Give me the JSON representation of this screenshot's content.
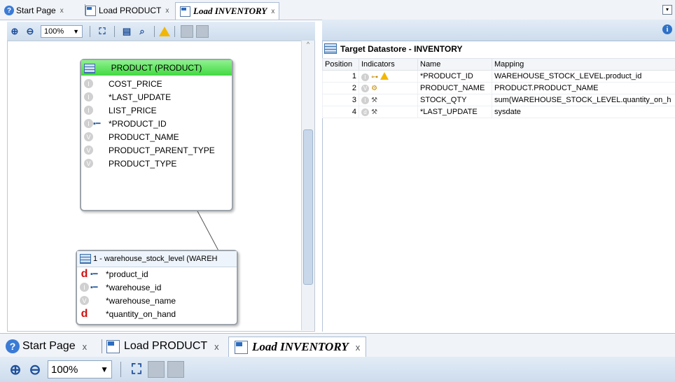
{
  "tabs": [
    {
      "label": "Start Page",
      "close": "x",
      "icon": "help-icon"
    },
    {
      "label": "Load PRODUCT",
      "close": "x",
      "icon": "mapping-icon"
    },
    {
      "label": "Load INVENTORY",
      "close": "x",
      "icon": "mapping-icon",
      "active": true
    }
  ],
  "toolbar": {
    "zoom": "100%"
  },
  "diagram": {
    "product": {
      "title": "PRODUCT (PRODUCT)",
      "attributes": [
        "COST_PRICE",
        "*LAST_UPDATE",
        "LIST_PRICE",
        "*PRODUCT_ID",
        "PRODUCT_NAME",
        "PRODUCT_PARENT_TYPE",
        "PRODUCT_TYPE"
      ]
    },
    "stock": {
      "title": "1 - warehouse_stock_level (WAREH",
      "attributes": [
        "*product_id",
        "*warehouse_id",
        "*warehouse_name",
        "*quantity_on_hand"
      ]
    }
  },
  "target": {
    "title": "Target Datastore - INVENTORY",
    "columns": [
      "Position",
      "Indicators",
      "Name",
      "Mapping"
    ],
    "rows": [
      {
        "pos": "1",
        "name": "*PRODUCT_ID",
        "mapping": "WAREHOUSE_STOCK_LEVEL.product_id"
      },
      {
        "pos": "2",
        "name": "PRODUCT_NAME",
        "mapping": "PRODUCT.PRODUCT_NAME"
      },
      {
        "pos": "3",
        "name": "STOCK_QTY",
        "mapping": "sum(WAREHOUSE_STOCK_LEVEL.quantity_on_h"
      },
      {
        "pos": "4",
        "name": "*LAST_UPDATE",
        "mapping": "sysdate"
      }
    ]
  },
  "colors": {
    "entity_header": "#42d942",
    "accent": "#2f71c7",
    "warning": "#f2b705"
  }
}
